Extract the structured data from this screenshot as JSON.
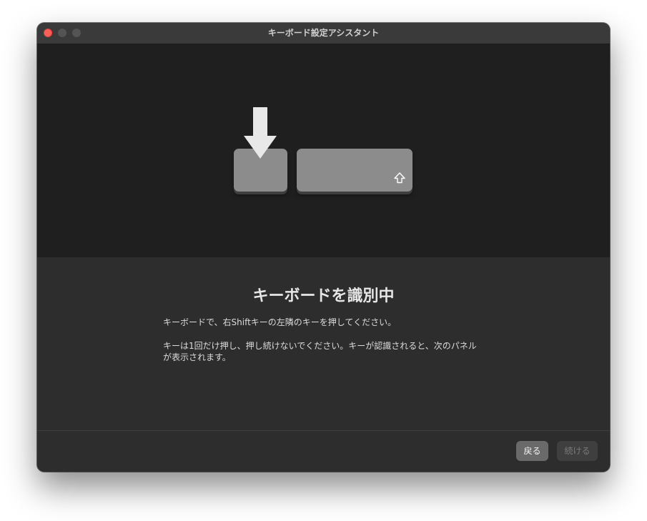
{
  "window": {
    "title": "キーボード設定アシスタント"
  },
  "illustration": {
    "arrow_icon": "down-arrow-icon",
    "shift_icon": "shift-icon"
  },
  "content": {
    "heading": "キーボードを識別中",
    "paragraph1": "キーボードで、右Shiftキーの左隣のキーを押してください。",
    "paragraph2": "キーは1回だけ押し、押し続けないでください。キーが認識されると、次のパネルが表示されます。"
  },
  "footer": {
    "back_label": "戻る",
    "continue_label": "続ける",
    "continue_enabled": false
  },
  "colors": {
    "close": "#ff5f57",
    "window_bg": "#2d2d2d",
    "illustration_bg": "#1f1f1f",
    "key": "#8c8c8c"
  }
}
